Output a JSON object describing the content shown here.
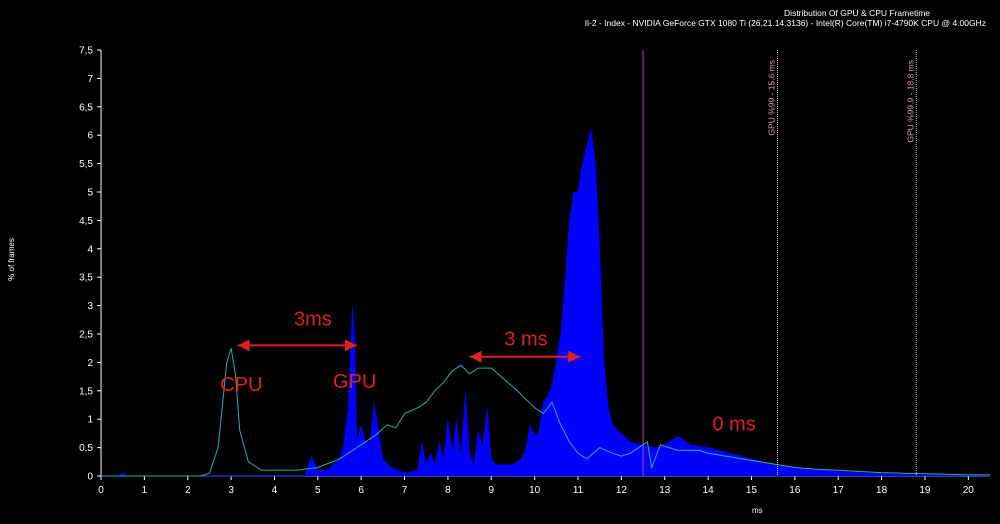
{
  "chart_data": {
    "type": "area",
    "title": "Distribution Of GPU & CPU Frametime",
    "subtitle": "Il-2 - Index - NVIDIA GeForce GTX 1080 Ti (26.21.14.3136) - Intel(R) Core(TM) i7-4790K CPU @ 4.00GHz",
    "xlabel": "ms",
    "ylabel": "% of frames",
    "xlim": [
      0,
      20.5
    ],
    "ylim": [
      0,
      7.5
    ],
    "x_ticks": [
      "0",
      "1",
      "2",
      "3",
      "4",
      "5",
      "6",
      "7",
      "8",
      "9",
      "10",
      "11",
      "12",
      "13",
      "14",
      "15",
      "16",
      "17",
      "18",
      "19",
      "20"
    ],
    "y_ticks": [
      "0",
      "0,5",
      "1",
      "1,5",
      "2",
      "2,5",
      "3",
      "3,5",
      "4",
      "4,5",
      "5",
      "5,5",
      "6",
      "6,5",
      "7",
      "7,5"
    ],
    "grid": false,
    "series": [
      {
        "name": "GPU",
        "color": "#0000ff",
        "style": "filled-area",
        "x": [
          0,
          0.4,
          0.5,
          0.6,
          2.0,
          4.7,
          4.85,
          5.0,
          5.2,
          5.5,
          5.6,
          5.7,
          5.8,
          5.85,
          5.9,
          6.0,
          6.1,
          6.2,
          6.3,
          6.4,
          6.5,
          6.7,
          7.0,
          7.3,
          7.4,
          7.5,
          7.6,
          7.7,
          7.8,
          7.9,
          8.0,
          8.1,
          8.2,
          8.3,
          8.4,
          8.5,
          8.6,
          8.7,
          8.8,
          8.9,
          9.0,
          9.1,
          9.3,
          9.5,
          9.7,
          9.8,
          9.9,
          10.0,
          10.1,
          10.2,
          10.3,
          10.4,
          10.5,
          10.6,
          10.7,
          10.8,
          10.9,
          11.0,
          11.1,
          11.2,
          11.3,
          11.4,
          11.5,
          11.6,
          11.7,
          11.8,
          11.9,
          12.0,
          12.2,
          12.5,
          12.8,
          13.0,
          13.3,
          13.6,
          14.0,
          14.5,
          15.0,
          15.5,
          16.0,
          17.0,
          18.0,
          19.0,
          20.0,
          20.5
        ],
        "y": [
          0,
          0,
          0.05,
          0,
          0,
          0,
          0.35,
          0.1,
          0.1,
          0.3,
          0.55,
          1.2,
          3.0,
          2.5,
          0.6,
          0.9,
          0.6,
          0.6,
          1.3,
          0.8,
          0.3,
          0.15,
          0.05,
          0.1,
          0.6,
          0.2,
          0.4,
          0.2,
          0.6,
          0.3,
          1.0,
          0.4,
          1.0,
          0.3,
          1.5,
          0.4,
          0.2,
          0.8,
          0.5,
          1.2,
          0.3,
          0.2,
          0.2,
          0.2,
          0.3,
          0.5,
          0.9,
          0.7,
          0.8,
          1.3,
          1.4,
          1.6,
          2.0,
          2.5,
          3.4,
          4.5,
          5.0,
          5.0,
          5.5,
          5.8,
          6.1,
          5.5,
          4.0,
          2.0,
          1.2,
          0.9,
          0.8,
          0.75,
          0.6,
          0.55,
          0.5,
          0.55,
          0.7,
          0.55,
          0.5,
          0.4,
          0.3,
          0.2,
          0.15,
          0.08,
          0.04,
          0.02,
          0.01,
          0
        ]
      },
      {
        "name": "CPU",
        "color": "#20b2aa",
        "style": "line",
        "x": [
          0,
          2.3,
          2.5,
          2.7,
          2.9,
          3.0,
          3.1,
          3.2,
          3.4,
          3.7,
          4.0,
          4.5,
          5.0,
          5.5,
          5.7,
          5.9,
          6.1,
          6.3,
          6.6,
          6.8,
          7.0,
          7.3,
          7.5,
          7.7,
          7.9,
          8.1,
          8.3,
          8.5,
          8.7,
          9.0,
          9.3,
          9.6,
          9.8,
          10.0,
          10.2,
          10.4,
          10.6,
          10.8,
          11.0,
          11.2,
          11.5,
          11.8,
          12.0,
          12.2,
          12.4,
          12.6,
          12.7,
          12.9,
          13.1,
          13.3,
          13.5,
          13.8,
          14.0,
          14.4,
          14.8,
          15.2,
          15.6,
          16.0,
          16.5,
          17.0,
          17.5,
          18.0,
          18.5,
          19.0,
          19.5,
          20.0,
          20.5
        ],
        "y": [
          0,
          0,
          0.05,
          0.5,
          2.0,
          2.25,
          1.8,
          0.8,
          0.25,
          0.1,
          0.1,
          0.1,
          0.15,
          0.3,
          0.4,
          0.5,
          0.6,
          0.7,
          0.9,
          0.85,
          1.1,
          1.2,
          1.3,
          1.5,
          1.65,
          1.85,
          1.95,
          1.8,
          1.9,
          1.9,
          1.7,
          1.5,
          1.35,
          1.2,
          1.1,
          1.3,
          0.9,
          0.6,
          0.4,
          0.3,
          0.5,
          0.4,
          0.35,
          0.4,
          0.5,
          0.6,
          0.15,
          0.55,
          0.5,
          0.45,
          0.45,
          0.45,
          0.4,
          0.35,
          0.3,
          0.25,
          0.2,
          0.15,
          0.12,
          0.1,
          0.08,
          0.06,
          0.05,
          0.04,
          0.03,
          0.02,
          0.02
        ]
      }
    ],
    "vlines": [
      {
        "x": 12.5,
        "color": "#c040c0",
        "label": ""
      },
      {
        "x": 15.6,
        "color": "#c8c8c8",
        "label": "GPU %99 - 15.6 ms"
      },
      {
        "x": 18.8,
        "color": "#c8c8c8",
        "label": "GPU %99.9 - 18.8 ms"
      }
    ],
    "annotations": [
      {
        "text": "CPU",
        "x": 2.75,
        "y": 1.5
      },
      {
        "text": "GPU",
        "x": 5.35,
        "y": 1.55
      },
      {
        "text": "3ms",
        "x": 4.45,
        "y": 2.65
      },
      {
        "text": "3 ms",
        "x": 9.3,
        "y": 2.3
      },
      {
        "text": "0 ms",
        "x": 14.1,
        "y": 0.8
      }
    ],
    "arrows": [
      {
        "x1": 3.15,
        "x2": 5.9,
        "y": 2.3
      },
      {
        "x1": 8.5,
        "x2": 11.05,
        "y": 2.1
      }
    ],
    "annotation_color": "#e02020"
  }
}
